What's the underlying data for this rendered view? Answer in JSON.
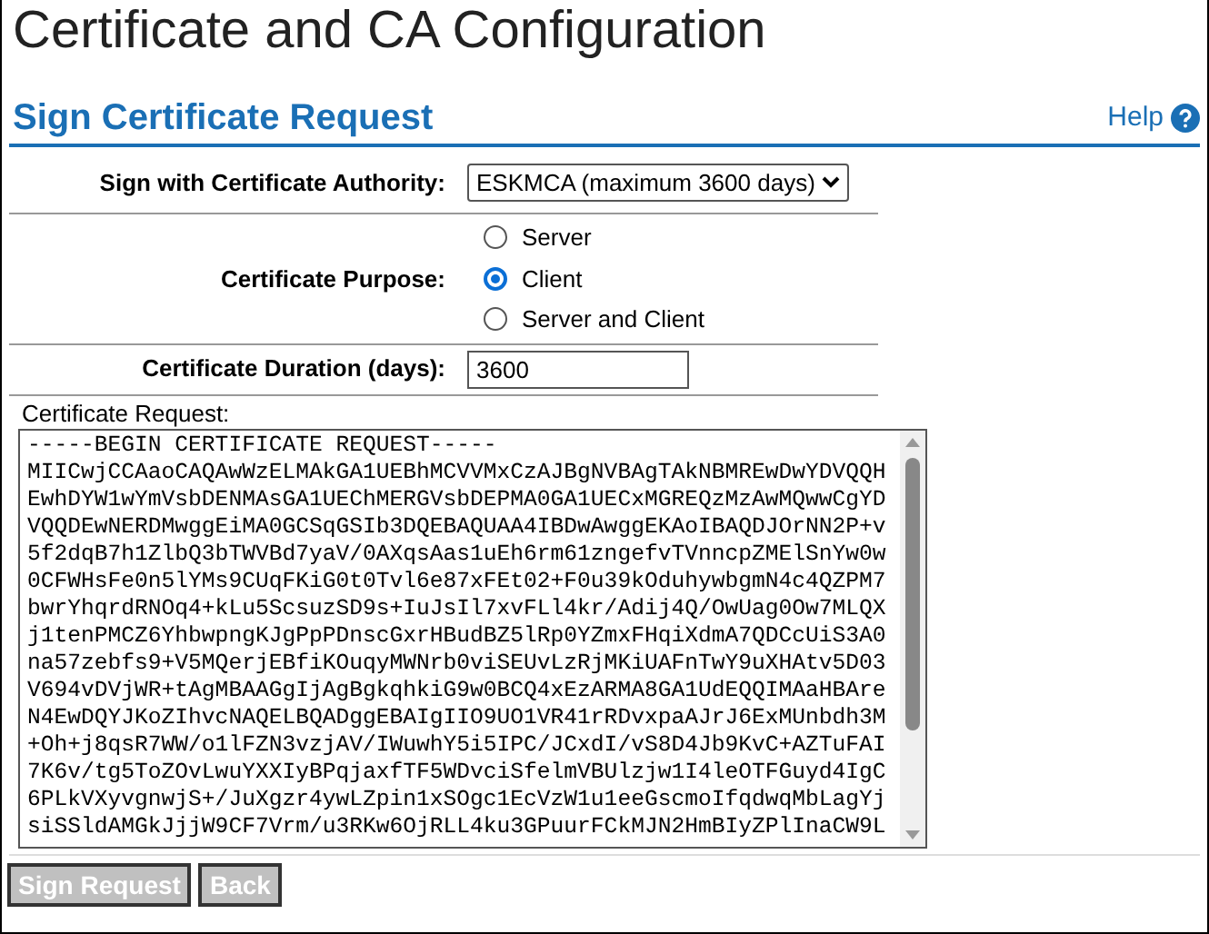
{
  "page_title": "Certificate and CA Configuration",
  "section": {
    "title": "Sign Certificate Request",
    "help": "Help"
  },
  "ca_field": {
    "label": "Sign with Certificate Authority:",
    "value": "ESKMCA (maximum 3600 days)"
  },
  "purpose": {
    "label": "Certificate Purpose:",
    "options": [
      {
        "label": "Server",
        "selected": false
      },
      {
        "label": "Client",
        "selected": true
      },
      {
        "label": "Server and Client",
        "selected": false
      }
    ]
  },
  "duration": {
    "label": "Certificate Duration (days):",
    "value": "3600"
  },
  "request": {
    "label": "Certificate Request:",
    "lines": [
      "-----BEGIN CERTIFICATE REQUEST-----",
      "MIICwjCCAaoCAQAwWzELMAkGA1UEBhMCVVMxCzAJBgNVBAgTAkNBMREwDwYDVQQH",
      "EwhDYW1wYmVsbDENMAsGA1UEChMERGVsbDEPMA0GA1UECxMGREQzMzAwMQwwCgYD",
      "VQQDEwNERDMwggEiMA0GCSqGSIb3DQEBAQUAA4IBDwAwggEKAoIBAQDJOrNN2P+v",
      "5f2dqB7h1ZlbQ3bTWVBd7yaV/0AXqsAas1uEh6rm61zngefvTVnncpZMElSnYw0w",
      "0CFWHsFe0n5lYMs9CUqFKiG0t0Tvl6e87xFEt02+F0u39kOduhywbgmN4c4QZPM7",
      "bwrYhqrdRNOq4+kLu5ScsuzSD9s+IuJsIl7xvFLl4kr/Adij4Q/OwUag0Ow7MLQX",
      "j1tenPMCZ6YhbwpngKJgPpPDnscGxrHBudBZ5lRp0YZmxFHqiXdmA7QDCcUiS3A0",
      "na57zebfs9+V5MQerjEBfiKOuqyMWNrb0viSEUvLzRjMKiUAFnTwY9uXHAtv5D03",
      "V694vDVjWR+tAgMBAAGgIjAgBgkqhkiG9w0BCQ4xEzARMA8GA1UdEQQIMAaHBAre",
      "N4EwDQYJKoZIhvcNAQELBQADggEBAIgIIO9UO1VR41rRDvxpaAJrJ6ExMUnbdh3M",
      "+Oh+j8qsR7WW/o1lFZN3vzjAV/IWuwhY5i5IPC/JCxdI/vS8D4Jb9KvC+AZTuFAI",
      "7K6v/tg5ToZOvLwuYXXIyBPqjaxfTF5WDvciSfelmVBUlzjw1I4leOTFGuyd4IgC",
      "6PLkVXyvgnwjS+/JuXgzr4ywLZpin1xSOgc1EcVzW1u1eeGscmoIfqdwqMbLagYj",
      "siSSldAMGkJjjW9CF7Vrm/u3RKw6OjRLL4ku3GPuurFCkMJN2HmBIyZPlInaCW9L"
    ]
  },
  "buttons": [
    {
      "label": "Sign Request",
      "disabled": true
    },
    {
      "label": "Back",
      "disabled": true
    }
  ]
}
